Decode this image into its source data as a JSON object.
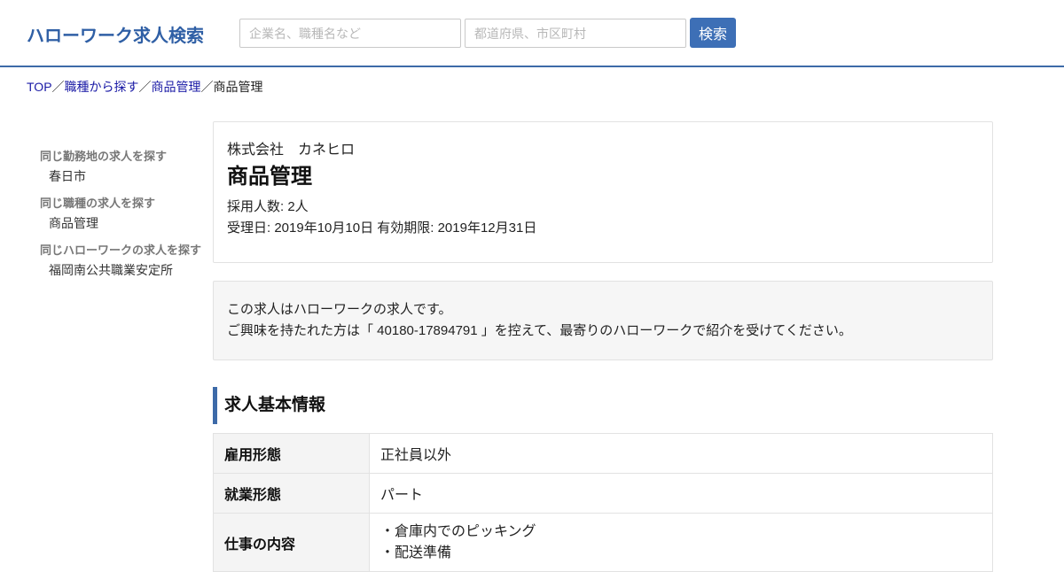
{
  "header": {
    "site_title": "ハローワーク求人検索",
    "keyword_placeholder": "企業名、職種名など",
    "location_placeholder": "都道府県、市区町村",
    "search_button": "検索"
  },
  "breadcrumb": {
    "items": [
      "TOP",
      "職種から探す",
      "商品管理"
    ],
    "current": "商品管理",
    "separator": "／"
  },
  "sidebar": {
    "groups": [
      {
        "heading": "同じ勤務地の求人を探す",
        "link": "春日市"
      },
      {
        "heading": "同じ職種の求人を探す",
        "link": "商品管理"
      },
      {
        "heading": "同じハローワークの求人を探す",
        "link": "福岡南公共職業安定所"
      }
    ]
  },
  "job": {
    "company": "株式会社　カネヒロ",
    "title": "商品管理",
    "hires": "採用人数: 2人",
    "dates": "受理日: 2019年10月10日 有効期限: 2019年12月31日"
  },
  "notice": {
    "line1": "この求人はハローワークの求人です。",
    "line2": "ご興味を持たれた方は「 40180-17894791 」を控えて、最寄りのハローワークで紹介を受けてください。"
  },
  "section": {
    "heading": "求人基本情報"
  },
  "table": {
    "rows": [
      {
        "label": "雇用形態",
        "value": "正社員以外"
      },
      {
        "label": "就業形態",
        "value": "パート"
      },
      {
        "label": "仕事の内容",
        "lines": [
          "・倉庫内でのピッキング",
          "・配送準備"
        ]
      }
    ]
  },
  "colors": {
    "brand": "#2f5fa5",
    "header_rule": "#3d6aa8",
    "button": "#3d6fb6",
    "link": "#1a1aa6"
  }
}
